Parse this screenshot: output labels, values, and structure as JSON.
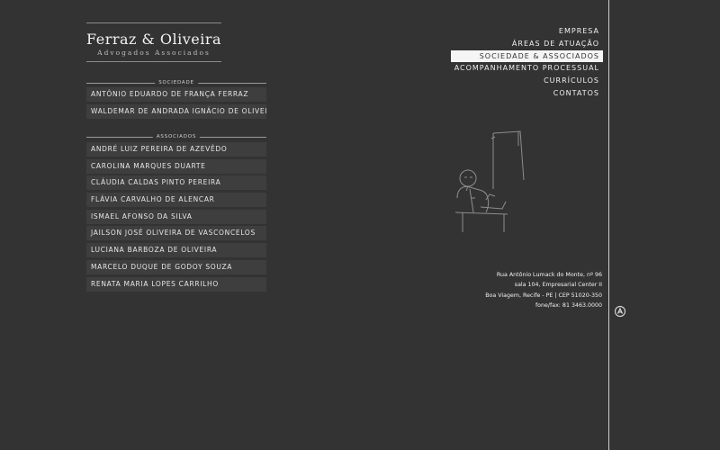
{
  "logo": {
    "name": "Ferraz & Oliveira",
    "subtitle": "Advogados Associados"
  },
  "sociedade": {
    "header": "SOCIEDADE",
    "items": [
      "ANTÔNIO EDUARDO DE FRANÇA FERRAZ",
      "WALDEMAR DE ANDRADA IGNÁCIO DE OLIVEIRA"
    ]
  },
  "associados": {
    "header": "ASSOCIADOS",
    "items": [
      "ANDRÉ LUIZ PEREIRA DE AZEVÊDO",
      "CAROLINA MARQUES DUARTE",
      "CLÁUDIA CALDAS PINTO PEREIRA",
      "FLÁVIA CARVALHO DE ALENCAR",
      "ISMAEL AFONSO DA SILVA",
      "JAILSON JOSÉ OLIVEIRA DE VASCONCELOS",
      "LUCIANA BARBOZA DE OLIVEIRA",
      "MARCELO DUQUE DE GODOY SOUZA",
      "RENATA MARIA LOPES CARRILHO"
    ]
  },
  "nav": {
    "items": [
      {
        "label": "EMPRESA",
        "active": false
      },
      {
        "label": "ÁREAS DE ATUAÇÃO",
        "active": false
      },
      {
        "label": "SOCIEDADE & ASSOCIADOS",
        "active": true
      },
      {
        "label": "ACOMPANHAMENTO PROCESSUAL",
        "active": false
      },
      {
        "label": "CURRÍCULOS",
        "active": false
      },
      {
        "label": "CONTATOS",
        "active": false
      }
    ]
  },
  "address": {
    "line1": "Rua Antônio Lumack do Monte, nº 96",
    "line2": "sala 104, Empresarial Center II",
    "line3": "Boa Viagem, Recife - PE | CEP 51020-350",
    "line4": "fone/fax: 81 3463.0000"
  },
  "icons": {
    "illustration": "lawyer-at-desk-illustration",
    "badge": "designer-badge-icon"
  },
  "colors": {
    "background": "#333333",
    "item_bg": "#3e3e3e",
    "text": "#e8e8e8",
    "active_bg": "#f5f5f5"
  }
}
